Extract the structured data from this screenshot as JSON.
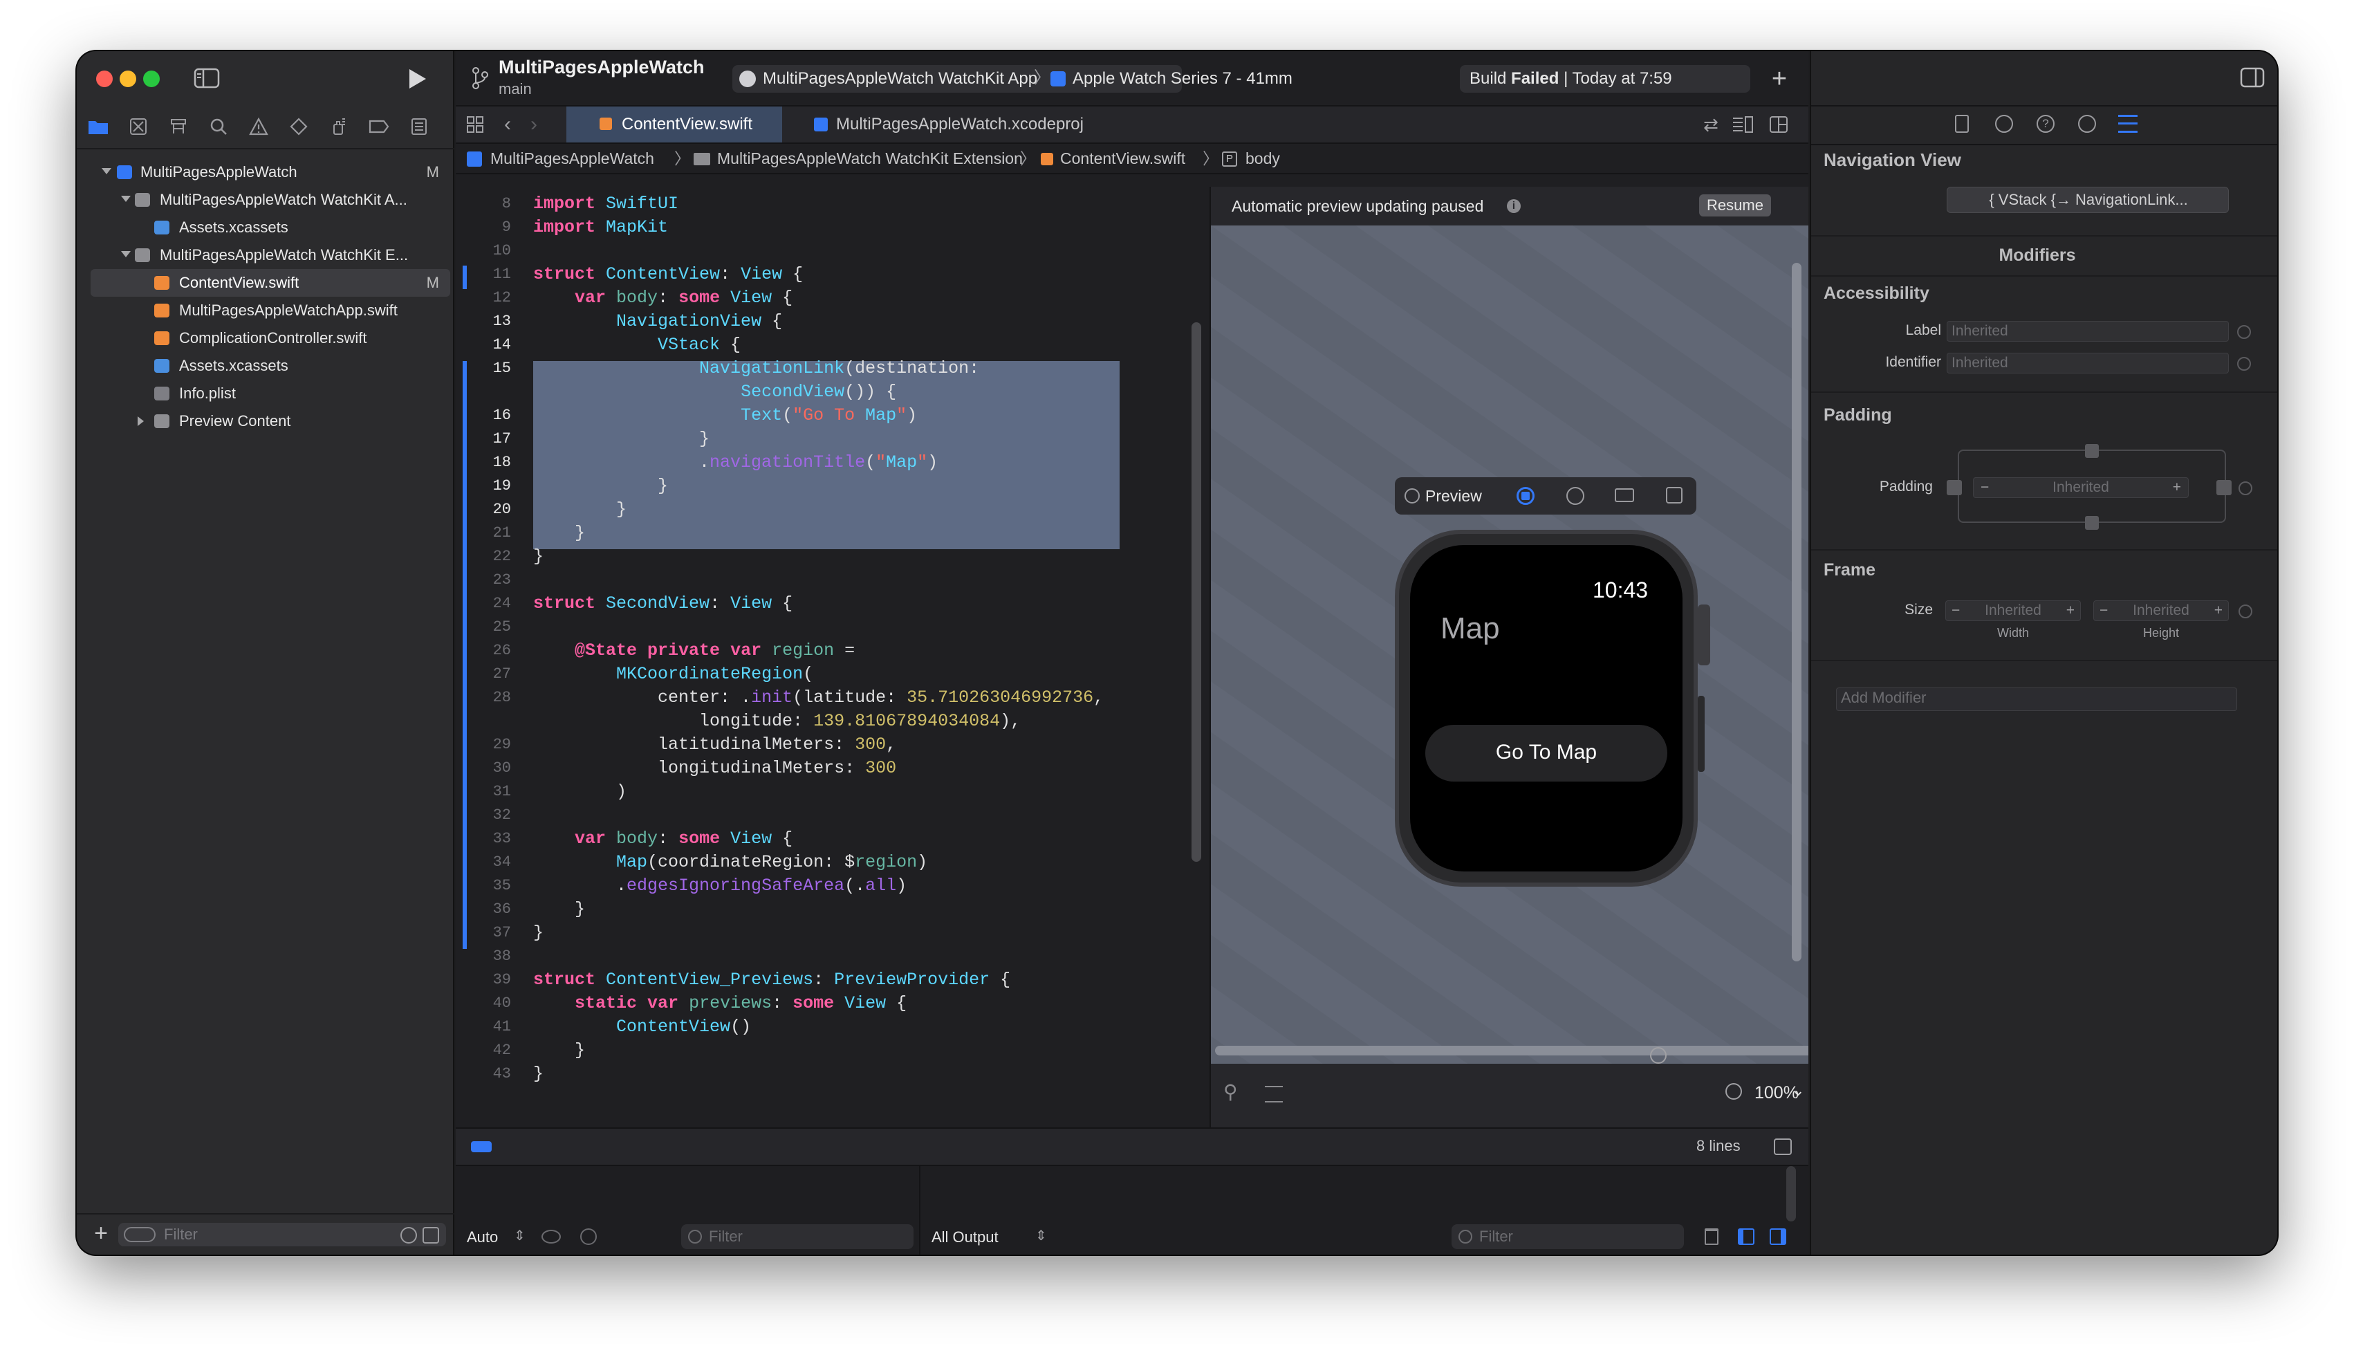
{
  "window": {
    "scheme_name": "MultiPagesAppleWatch",
    "branch": "main",
    "target": "MultiPagesAppleWatch WatchKit App",
    "device": "Apple Watch Series 7 - 41mm",
    "build_status_prefix": "Build",
    "build_status_result": "Failed",
    "build_status_suffix": "| Today at 7:59"
  },
  "navigator": {
    "items": [
      {
        "label": "MultiPagesAppleWatch",
        "badge": "M"
      },
      {
        "label": "MultiPagesAppleWatch WatchKit A...",
        "badge": ""
      },
      {
        "label": "Assets.xcassets",
        "badge": ""
      },
      {
        "label": "MultiPagesAppleWatch WatchKit E...",
        "badge": ""
      },
      {
        "label": "ContentView.swift",
        "badge": "M"
      },
      {
        "label": "MultiPagesAppleWatchApp.swift",
        "badge": ""
      },
      {
        "label": "ComplicationController.swift",
        "badge": ""
      },
      {
        "label": "Assets.xcassets",
        "badge": ""
      },
      {
        "label": "Info.plist",
        "badge": ""
      },
      {
        "label": "Preview Content",
        "badge": ""
      }
    ],
    "filter_placeholder": "Filter"
  },
  "tabs": {
    "active": "ContentView.swift",
    "other": "MultiPagesAppleWatch.xcodeproj"
  },
  "breadcrumb": {
    "project": "MultiPagesAppleWatch",
    "group": "MultiPagesAppleWatch WatchKit Extension",
    "file": "ContentView.swift",
    "symbol": "body"
  },
  "editor": {
    "lines": [
      {
        "n": "8",
        "text": "import SwiftUI"
      },
      {
        "n": "9",
        "text": "import MapKit"
      },
      {
        "n": "10",
        "text": ""
      },
      {
        "n": "11",
        "text": "struct ContentView: View {"
      },
      {
        "n": "12",
        "text": "    var body: some View {"
      },
      {
        "n": "13",
        "text": "        NavigationView {"
      },
      {
        "n": "14",
        "text": "            VStack {"
      },
      {
        "n": "15",
        "text": "                NavigationLink(destination:"
      },
      {
        "n": "",
        "text": "                    SecondView()) {"
      },
      {
        "n": "16",
        "text": "                    Text(\"Go To Map\")"
      },
      {
        "n": "17",
        "text": "                }"
      },
      {
        "n": "18",
        "text": "                .navigationTitle(\"Map\")"
      },
      {
        "n": "19",
        "text": "            }"
      },
      {
        "n": "20",
        "text": "        }"
      },
      {
        "n": "21",
        "text": "    }"
      },
      {
        "n": "22",
        "text": "}"
      },
      {
        "n": "23",
        "text": ""
      },
      {
        "n": "24",
        "text": "struct SecondView: View {"
      },
      {
        "n": "25",
        "text": ""
      },
      {
        "n": "26",
        "text": "    @State private var region ="
      },
      {
        "n": "27",
        "text": "        MKCoordinateRegion("
      },
      {
        "n": "28",
        "text": "            center: .init(latitude: 35.710263046992736,"
      },
      {
        "n": "",
        "text": "                longitude: 139.81067894034084),"
      },
      {
        "n": "29",
        "text": "            latitudinalMeters: 300,"
      },
      {
        "n": "30",
        "text": "            longitudinalMeters: 300"
      },
      {
        "n": "31",
        "text": "        )"
      },
      {
        "n": "32",
        "text": ""
      },
      {
        "n": "33",
        "text": "    var body: some View {"
      },
      {
        "n": "34",
        "text": "        Map(coordinateRegion: $region)"
      },
      {
        "n": "35",
        "text": "        .edgesIgnoringSafeArea(.all)"
      },
      {
        "n": "36",
        "text": "    }"
      },
      {
        "n": "37",
        "text": "}"
      },
      {
        "n": "38",
        "text": ""
      },
      {
        "n": "39",
        "text": "struct ContentView_Previews: PreviewProvider {"
      },
      {
        "n": "40",
        "text": "    static var previews: some View {"
      },
      {
        "n": "41",
        "text": "        ContentView()"
      },
      {
        "n": "42",
        "text": "    }"
      },
      {
        "n": "43",
        "text": "}"
      }
    ],
    "line_count": "8 lines"
  },
  "canvas": {
    "banner": "Automatic preview updating paused",
    "resume_label": "Resume",
    "preview_label": "Preview",
    "watch_time": "10:43",
    "watch_title": "Map",
    "watch_button": "Go To Map",
    "zoom": "100%"
  },
  "debug": {
    "auto_label": "Auto",
    "output_label": "All Output",
    "filter_placeholder": "Filter"
  },
  "inspector": {
    "title": "Navigation View",
    "view_stack": "{ VStack {→ NavigationLink...",
    "modifiers_header": "Modifiers",
    "accessibility": "Accessibility",
    "label": "Label",
    "identifier": "Identifier",
    "inherited": "Inherited",
    "padding_section": "Padding",
    "padding_label": "Padding",
    "frame": "Frame",
    "size": "Size",
    "width": "Width",
    "height": "Height",
    "add_modifier_placeholder": "Add Modifier"
  },
  "colors": {
    "accent": "#3478f6",
    "selection": "#5e6b85",
    "canvas_bg": "#5d6370"
  }
}
